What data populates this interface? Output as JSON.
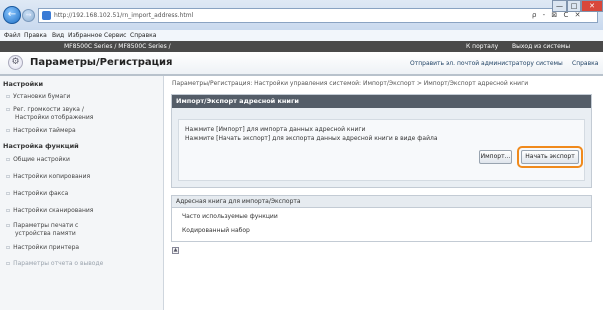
{
  "browser": {
    "back_label": "←",
    "forward_label": "→",
    "address_url": "http://192.168.102.51/rn_import_address.html",
    "address_tools": "ρ - ⊠ C ✕",
    "right_icons": "⌂ ☆ ⚙",
    "window_buttons": [
      "—",
      "□",
      "✕"
    ]
  },
  "menubar": {
    "items": [
      "Файл",
      "Правка",
      "Вид",
      "Избранное",
      "Сервис",
      "Справка"
    ]
  },
  "device_bar": {
    "title": "MF8500C Series / MF8500C Series /",
    "portal_link": "К порталу",
    "logout_link": "Выход из системы"
  },
  "header": {
    "icon": "⚙",
    "title": "Параметры/Регистрация",
    "mail_link": "Отправить эл. почтой администратору системы",
    "help_link": "Справка"
  },
  "sidebar": {
    "section1": "Настройки",
    "items1": [
      "Установки бумаги",
      "Рег. громкости звука /",
      "Настройки отображения",
      "Настройки таймера"
    ],
    "section2": "Настройка функций",
    "items2": [
      "Общие настройки",
      "Настройки копирования",
      "Настройки факса",
      "Настройки сканирования",
      "Параметры печати с",
      "устройства памяти",
      "Настройки принтера",
      "Параметры отчета о выводе"
    ]
  },
  "main": {
    "breadcrumb": "Параметры/Регистрация: Настройки управления системой: Импорт/Экспорт > Импорт/Экспорт адресной книги",
    "panel_title": "Импорт/Экспорт адресной книги",
    "line1": "Нажмите [Импорт] для импорта данных адресной книги",
    "line2": "Нажмите [Начать экспорт] для экспорта данных адресной книги в виде файла",
    "import_button": "Импорт...",
    "export_button": "Начать экспорт",
    "panel2_title": "Адресная книга для импорта/Экспорта",
    "row1": "Часто используемые функции",
    "row2": "Кодированный набор",
    "up_icon": "▲"
  },
  "colors": {
    "highlight": "#f08a1c",
    "panel_header": "#545d68",
    "device_bar": "#4a4a4a"
  }
}
